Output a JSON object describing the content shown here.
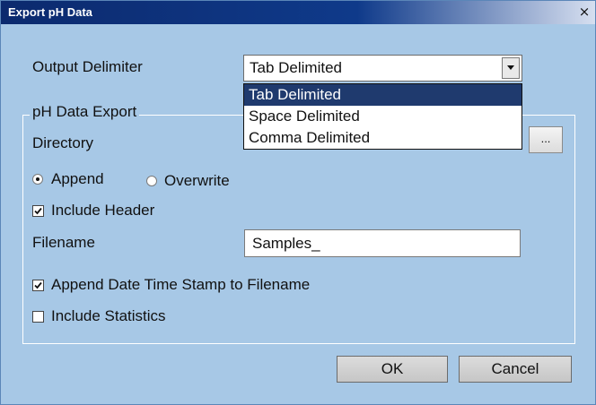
{
  "window": {
    "title": "Export pH Data",
    "close_symbol": "×"
  },
  "output_delimiter": {
    "label": "Output Delimiter",
    "selected": "Tab Delimited",
    "options": [
      "Tab Delimited",
      "Space Delimited",
      "Comma Delimited"
    ]
  },
  "group": {
    "legend": "pH Data Export",
    "directory_label": "Directory",
    "browse_label": "...",
    "append_label": "Append",
    "overwrite_label": "Overwrite",
    "append_selected": true,
    "include_header_label": "Include Header",
    "include_header_checked": true,
    "filename_label": "Filename",
    "filename_value": "Samples_",
    "append_timestamp_label": "Append Date Time Stamp to Filename",
    "append_timestamp_checked": true,
    "include_statistics_label": "Include Statistics",
    "include_statistics_checked": false
  },
  "buttons": {
    "ok": "OK",
    "cancel": "Cancel"
  },
  "colors": {
    "background": "#a7c8e6",
    "titlebar": "#0c2a6e",
    "selection": "#1f3a6e"
  }
}
